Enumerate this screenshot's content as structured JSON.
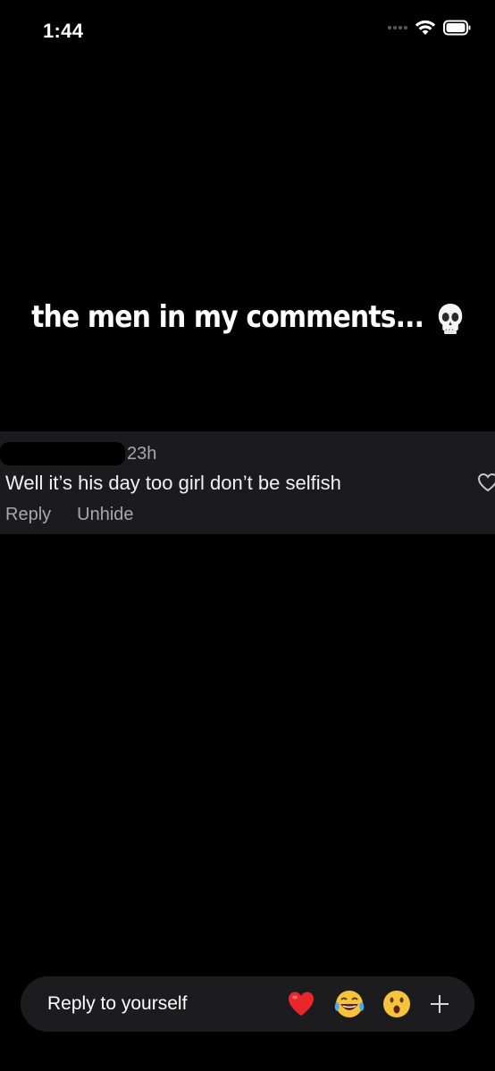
{
  "status_bar": {
    "time": "1:44"
  },
  "story": {
    "caption": "the men in my comments...",
    "caption_emoji": "skull-emoji"
  },
  "comment": {
    "time_ago": "23h",
    "text": "Well it’s his day too girl don’t be selfish",
    "actions": {
      "reply": "Reply",
      "unhide": "Unhide"
    },
    "like_icon": "heart-outline-icon"
  },
  "reply_bar": {
    "placeholder": "Reply to yourself",
    "reactions": [
      "heart-emoji",
      "tears-of-joy-emoji",
      "surprised-emoji"
    ],
    "more_icon": "plus-icon"
  },
  "colors": {
    "background": "#000000",
    "card": "#1b1b1d",
    "secondary_text": "#a8a8a8",
    "reply_bar": "#1c1c1e"
  }
}
